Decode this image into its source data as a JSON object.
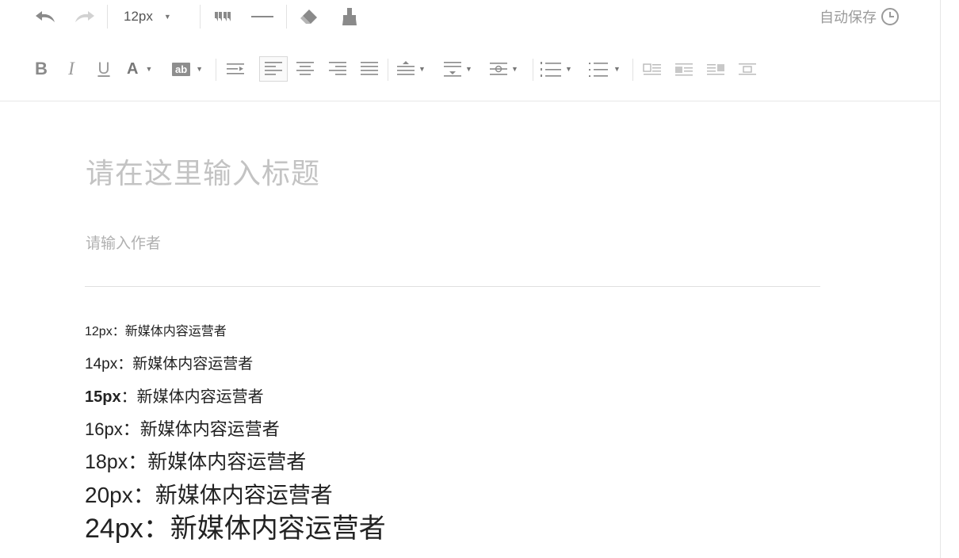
{
  "toolbar": {
    "font_size": "12px",
    "autosave_label": "自动保存",
    "bold_label": "B",
    "italic_label": "I",
    "underline_label": "U",
    "font_color_label": "A",
    "highlight_label": "ab"
  },
  "editor": {
    "title_placeholder": "请在这里输入标题",
    "author_placeholder": "请输入作者"
  },
  "samples": [
    {
      "label": "12px",
      "sep": "：",
      "text": "新媒体内容运营者"
    },
    {
      "label": "14px",
      "sep": "：",
      "text": "新媒体内容运营者"
    },
    {
      "label": "15px",
      "sep": "：",
      "text": "新媒体内容运营者"
    },
    {
      "label": "16px",
      "sep": "：",
      "text": "新媒体内容运营者"
    },
    {
      "label": "18px",
      "sep": "：",
      "text": "新媒体内容运营者"
    },
    {
      "label": "20px",
      "sep": "：",
      "text": "新媒体内容运营者"
    },
    {
      "label": "24px",
      "sep": "：",
      "text": "新媒体内容运营者"
    }
  ],
  "colors": {
    "icon": "#8a8a8a",
    "placeholder": "#c3c3c3",
    "text": "#222222",
    "divider": "#e0e0e0"
  },
  "icons": [
    "undo-icon",
    "redo-icon",
    "quote-icon",
    "horizontal-rule-icon",
    "eraser-icon",
    "format-painter-icon",
    "clock-icon"
  ]
}
